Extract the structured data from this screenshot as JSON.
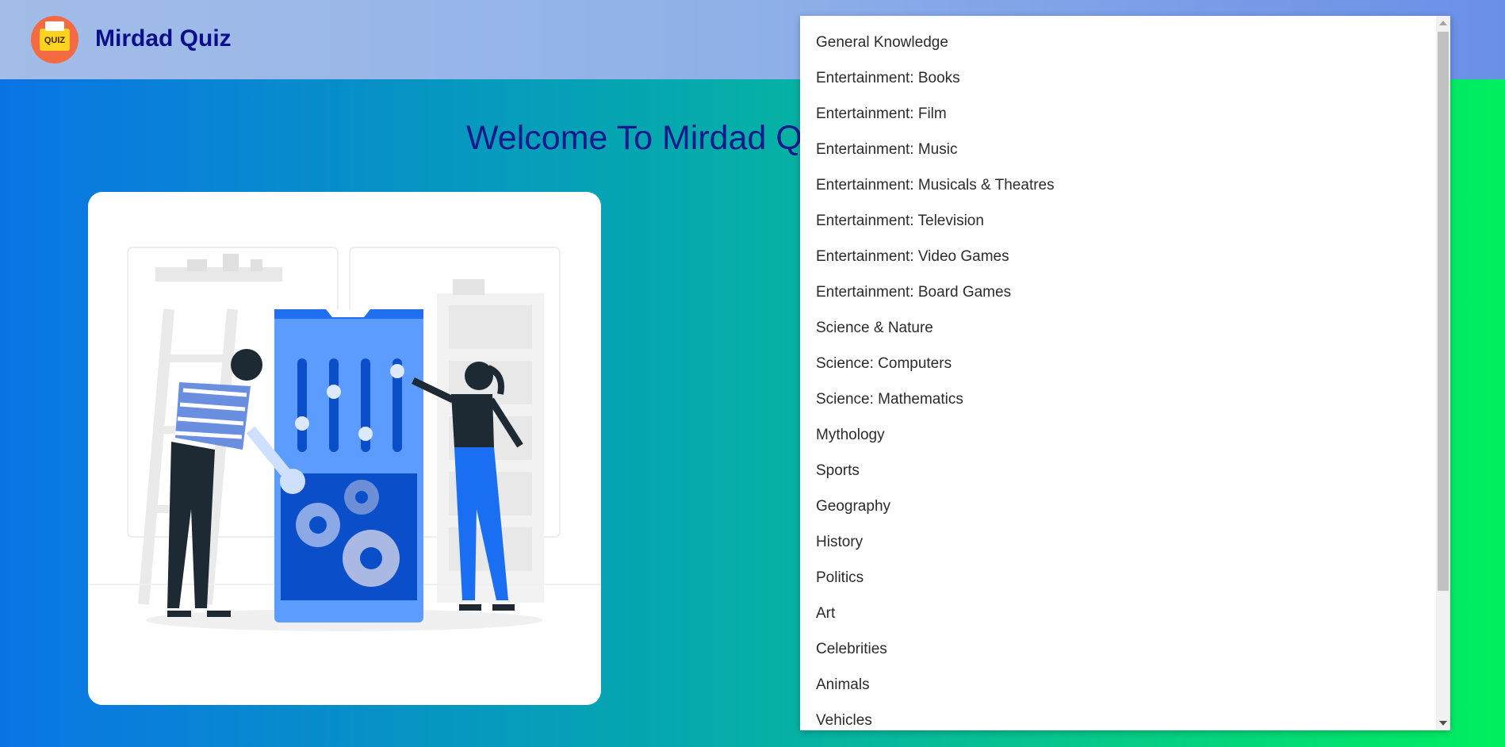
{
  "header": {
    "logo_text": "QUIZ",
    "brand_name": "Mirdad Quiz"
  },
  "main": {
    "welcome_text": "Welcome To Mirdad Q"
  },
  "illustration": {
    "icon": "settings-illustration"
  },
  "category_dropdown": {
    "options": [
      "General Knowledge",
      "Entertainment: Books",
      "Entertainment: Film",
      "Entertainment: Music",
      "Entertainment: Musicals & Theatres",
      "Entertainment: Television",
      "Entertainment: Video Games",
      "Entertainment: Board Games",
      "Science & Nature",
      "Science: Computers",
      "Science: Mathematics",
      "Mythology",
      "Sports",
      "Geography",
      "History",
      "Politics",
      "Art",
      "Celebrities",
      "Animals",
      "Vehicles"
    ]
  },
  "colors": {
    "brand_text": "#0b0f8c",
    "welcome_text": "#101a8a",
    "logo_bg": "#f36a43",
    "gradient_start": "#0a74e6",
    "gradient_end": "#00ef5f"
  }
}
